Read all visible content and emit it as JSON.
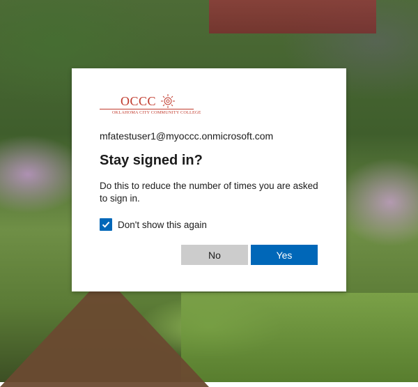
{
  "logo": {
    "wordmark": "OCCC",
    "subtitle": "OKLAHOMA CITY COMMUNITY COLLEGE",
    "brand_color": "#c0392b"
  },
  "account": {
    "email": "mfatestuser1@myoccc.onmicrosoft.com"
  },
  "dialog": {
    "title": "Stay signed in?",
    "description": "Do this to reduce the number of times you are asked to sign in.",
    "checkbox_label": "Don't show this again",
    "checkbox_checked": true
  },
  "buttons": {
    "no_label": "No",
    "yes_label": "Yes"
  },
  "colors": {
    "accent": "#0067b8",
    "secondary_button": "#cccccc"
  }
}
